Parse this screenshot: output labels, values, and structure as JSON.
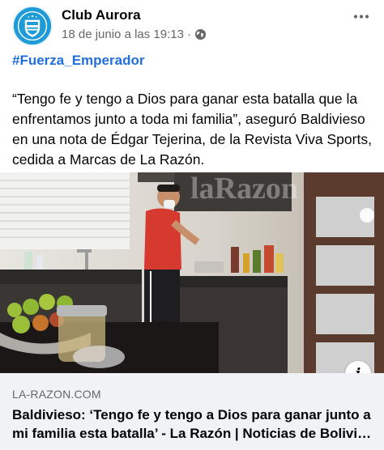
{
  "post": {
    "page_name": "Club Aurora",
    "timestamp": "18 de junio a las 19:13",
    "separator": "·",
    "privacy_icon": "globe-icon",
    "more_icon": "more-horizontal-icon",
    "hashtag": "#Fuerza_Emperador",
    "text": "“Tengo fe y tengo a Dios para ganar esta batalla que la enfrentamos junto a toda mi familia”, aseguró Baldivieso en una nota de Édgar Tejerina, de la Revista Viva Sports, cedida a Marcas de La Razón."
  },
  "link_preview": {
    "image_watermark": "laRazon",
    "info_icon": "info-icon",
    "info_label": "i",
    "domain": "LA-RAZON.COM",
    "title": "Baldivieso: ‘Tengo fe y tengo a Dios para ganar junto a mi familia esta batalla’ - La Razón | Noticias de Bolivia y el Mundo"
  },
  "colors": {
    "link_blue": "#216fdb",
    "secondary_text": "#65676b",
    "card_background": "#f0f2f5",
    "avatar_blue": "#1d9bd7"
  }
}
